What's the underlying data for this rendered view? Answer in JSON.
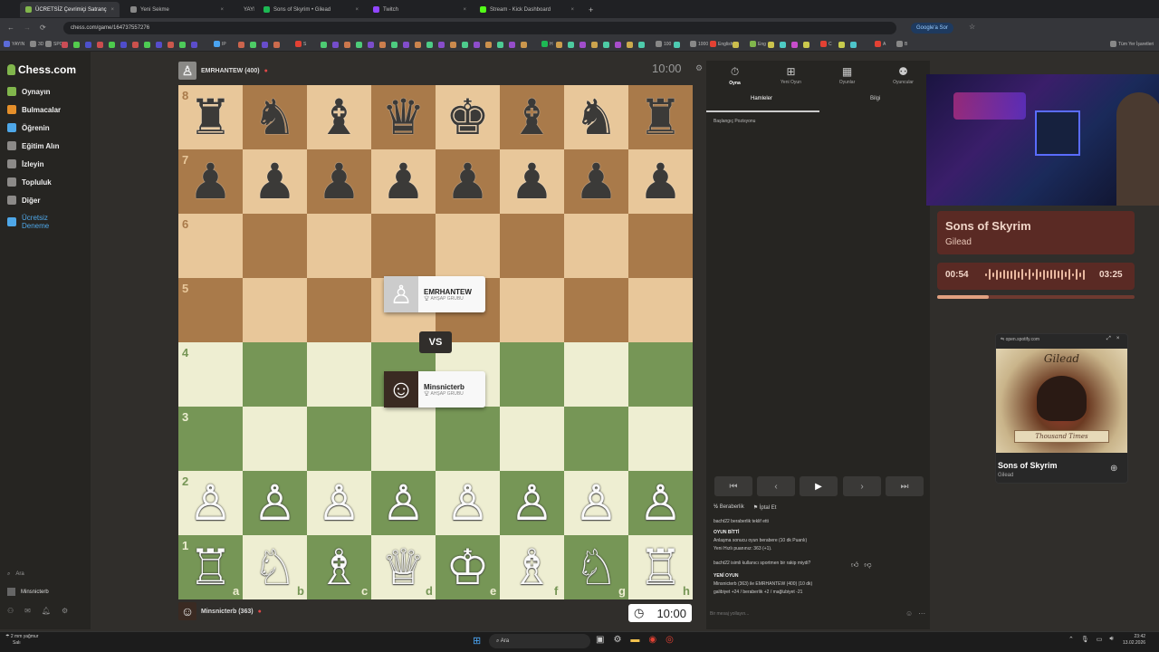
{
  "tabs": [
    {
      "label": "ÜCRETSİZ Çevrimiçi Satranç",
      "color": "#81b64c",
      "active": true
    },
    {
      "label": "Yeni Sekme",
      "color": "#888"
    },
    {
      "label": "YAYIN",
      "color": "#5b6bd8"
    },
    {
      "label": "Sons of Skyrim • Gilead",
      "color": "#1db954"
    },
    {
      "label": "Twitch",
      "color": "#9146ff"
    },
    {
      "label": "Stream - Kick Dashboard",
      "color": "#53fc18"
    }
  ],
  "address": {
    "url": "chess.com/game/164737557276",
    "google_btn": "Google'a Sor"
  },
  "bookmarks": [
    "YAYIN",
    "3D",
    "SPOR",
    "IP",
    "S",
    "H",
    "100",
    "1000",
    "English",
    "Eng",
    "C",
    "A",
    "B",
    "Tüm Yer İşaretleri"
  ],
  "sidebar": {
    "logo": "Chess.com",
    "items": [
      {
        "label": "Oynayın",
        "color": "#81b64c"
      },
      {
        "label": "Bulmacalar",
        "color": "#e58f2a"
      },
      {
        "label": "Öğrenin",
        "color": "#4ea7e8"
      },
      {
        "label": "Eğitim Alın",
        "color": "#8c8a88"
      },
      {
        "label": "İzleyin",
        "color": "#8c8a88"
      },
      {
        "label": "Topluluk",
        "color": "#8c8a88"
      },
      {
        "label": "Diğer",
        "color": "#8c8a88"
      },
      {
        "label": "Ücretsiz Deneme",
        "color": "#4ea7e8"
      }
    ],
    "search": "Ara",
    "user": "Minsnicterb"
  },
  "board": {
    "light": "#e8c79a",
    "dark": "#a97a4a",
    "green_light": "#eeeed2",
    "green_dark": "#769656",
    "top_rows": [
      "♜♞♝♛♚♝♞♜",
      "♟♟♟♟♟♟♟♟"
    ],
    "bottom_rows": [
      "♙♙♙♙♙♙♙♙",
      "♖♘♗♕♔♗♘♖"
    ],
    "ranks": [
      "8",
      "7",
      "6",
      "5",
      "4",
      "3",
      "2",
      "1"
    ],
    "files": [
      "a",
      "b",
      "c",
      "d",
      "e",
      "f",
      "g",
      "h"
    ]
  },
  "top_player": {
    "name": "EMRHANTEW (400)",
    "clock": "10:00"
  },
  "bottom_player": {
    "name": "Minsnicterb (363)",
    "clock": "10:00"
  },
  "vs_card": {
    "p1": {
      "name": "EMRHANTEW",
      "group": "AHŞAP GRUBU"
    },
    "vs": "VS",
    "p2": {
      "name": "Minsnicterb",
      "group": "AHŞAP GRUBU"
    }
  },
  "right_panel": {
    "top_tabs": [
      "Oyna",
      "Yeni Oyun",
      "Oyunlar",
      "Oyuncular"
    ],
    "sub_tabs": [
      "Hamleler",
      "Bilgi"
    ],
    "start_position": "Başlangıç Pozisyonu",
    "draw": "Beraberlik",
    "abort": "İptal Et",
    "chat": [
      {
        "t": "bacht22 beraberlik teklif etti",
        "b": false
      },
      {
        "t": "OYUN BİTTİ",
        "b": true
      },
      {
        "t": "Anlaşma sonucu oyun berabere (10 dk Puanlı)",
        "b": false
      },
      {
        "t": "Yeni Hızlı puanınız: 363 (+1).",
        "b": false
      },
      {
        "t": "bacht22 isimli kullanıcı sportmen bir rakip miydi?",
        "b": false
      },
      {
        "t": "YENİ OYUN",
        "b": true
      },
      {
        "t": "Minsnicterb (363) ile EMRHANTEW (400) (10 dk)",
        "b": false
      },
      {
        "t": "galibiyet +24 / beraberlik +2 / mağlubiyet -21",
        "b": false
      }
    ],
    "message_placeholder": "Bir mesaj yollayın..."
  },
  "spotify": {
    "title": "Sons of Skyrim",
    "artist": "Gilead",
    "elapsed": "00:54",
    "total": "03:25",
    "progress": 0.26,
    "popup_url": "open.spotify.com",
    "popup_title": "Sons of Skyrim",
    "popup_artist": "Gilead",
    "art_title": "Gilead",
    "art_sub": "Thousand Times"
  },
  "taskbar": {
    "weather": "2 mm yağmur",
    "weather_sub": "Salı",
    "search": "Ara",
    "time": "23:42",
    "date": "13.02.2026"
  }
}
